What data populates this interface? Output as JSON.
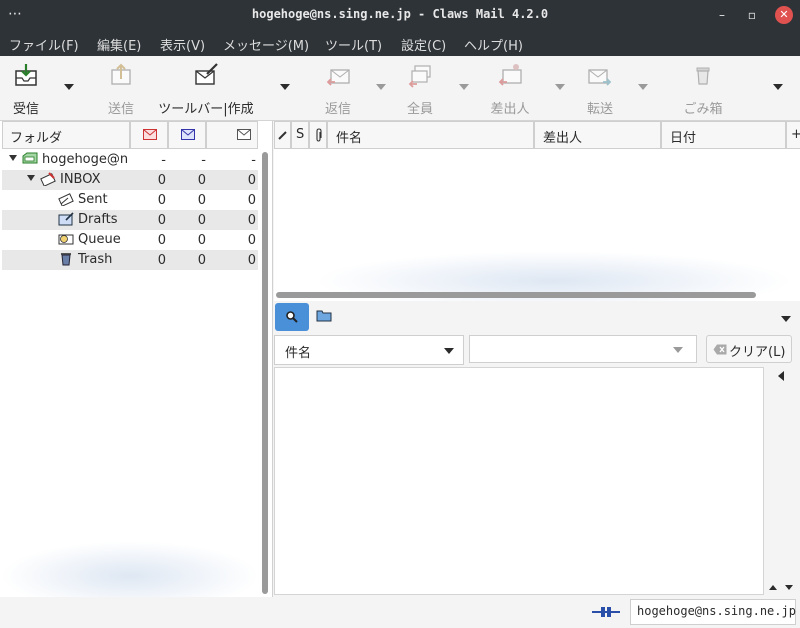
{
  "window": {
    "title": "hogehoge@ns.sing.ne.jp - Claws Mail 4.2.0",
    "dots": "⋯",
    "minimize": "–",
    "maximize": "▫",
    "close": "✕"
  },
  "menu": [
    "ファイル(F)",
    "編集(E)",
    "表示(V)",
    "メッセージ(M)",
    "ツール(T)",
    "設定(C)",
    "ヘルプ(H)"
  ],
  "toolbar": {
    "receive": "受信",
    "send": "送信",
    "compose": "ツールバー|作成",
    "reply": "返信",
    "reply_all": "全員",
    "reply_sender": "差出人",
    "forward": "転送",
    "trash": "ごみ箱"
  },
  "folder_pane": {
    "header": "フォルダ",
    "account": {
      "name": "hogehoge@ns",
      "counts": [
        "-",
        "-",
        "-"
      ]
    },
    "folders": [
      {
        "name": "INBOX",
        "counts": [
          "0",
          "0",
          "0"
        ]
      },
      {
        "name": "Sent",
        "counts": [
          "0",
          "0",
          "0"
        ]
      },
      {
        "name": "Drafts",
        "counts": [
          "0",
          "0",
          "0"
        ]
      },
      {
        "name": "Queue",
        "counts": [
          "0",
          "0",
          "0"
        ]
      },
      {
        "name": "Trash",
        "counts": [
          "0",
          "0",
          "0"
        ]
      }
    ]
  },
  "message_list": {
    "columns": {
      "status": "S",
      "subject": "件名",
      "from": "差出人",
      "date": "日付",
      "more": "+"
    }
  },
  "search": {
    "field": "件名",
    "value": "",
    "clear": "クリア(L)"
  },
  "status": {
    "account": "hogehoge@ns.sing.ne.jp"
  },
  "colors": {
    "titlebar": "#2e3338",
    "close": "#e0524f",
    "selected_tab": "#4a90d9"
  }
}
